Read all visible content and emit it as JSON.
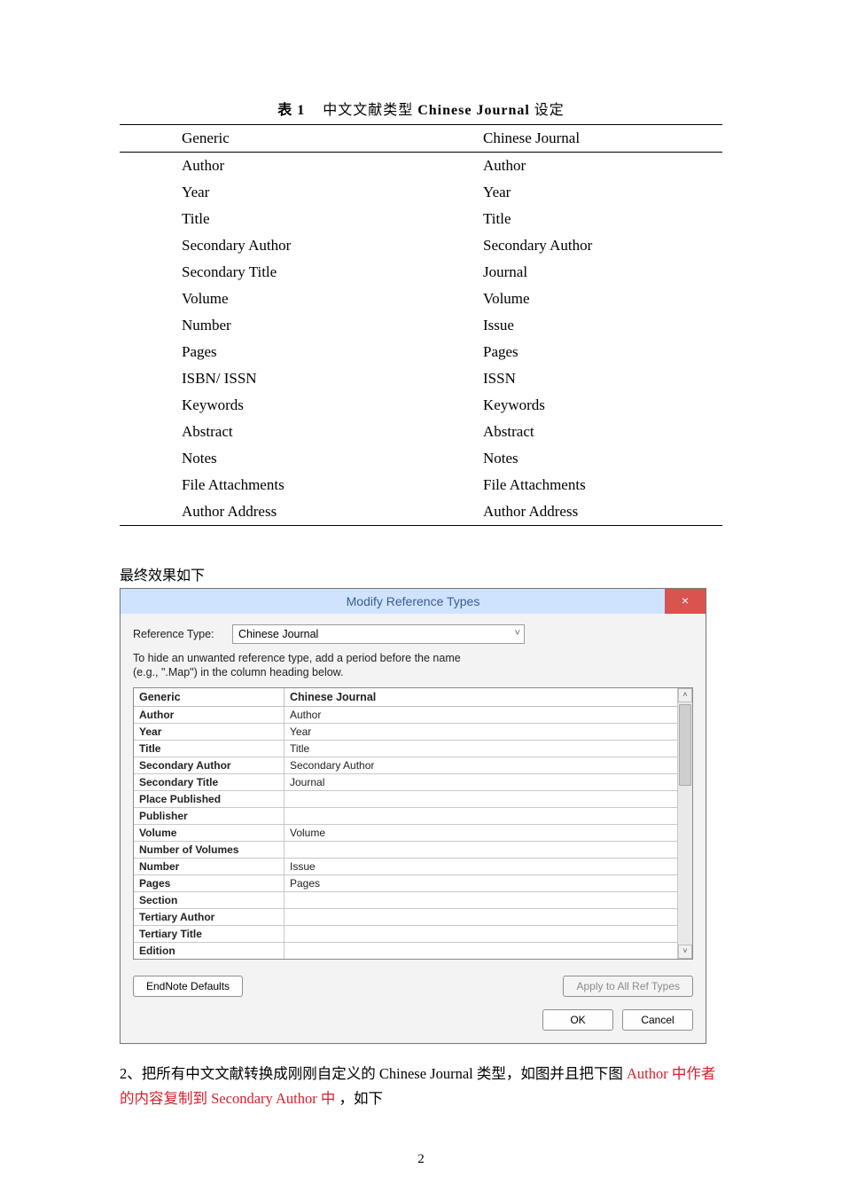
{
  "table1": {
    "caption_prefix": "表 1",
    "caption_text1": "中文文献类型",
    "caption_bold": "Chinese Journal",
    "caption_text2": "设定",
    "headers": {
      "left": "Generic",
      "right": "Chinese Journal"
    },
    "rows": [
      {
        "l": "Author",
        "r": "Author"
      },
      {
        "l": "Year",
        "r": "Year"
      },
      {
        "l": "Title",
        "r": "Title"
      },
      {
        "l": "Secondary Author",
        "r": "Secondary Author"
      },
      {
        "l": "Secondary Title",
        "r": "Journal"
      },
      {
        "l": "Volume",
        "r": "Volume"
      },
      {
        "l": "Number",
        "r": "Issue"
      },
      {
        "l": "Pages",
        "r": "Pages"
      },
      {
        "l": "ISBN/ ISSN",
        "r": "ISSN"
      },
      {
        "l": "Keywords",
        "r": "Keywords"
      },
      {
        "l": "Abstract",
        "r": "Abstract"
      },
      {
        "l": "Notes",
        "r": "Notes"
      },
      {
        "l": "File Attachments",
        "r": "File Attachments"
      },
      {
        "l": "Author Address",
        "r": "Author Address"
      }
    ]
  },
  "narration1": "最终效果如下",
  "dialog": {
    "title": "Modify Reference Types",
    "close_glyph": "×",
    "ref_type_label": "Reference Type:",
    "ref_type_value": "Chinese Journal",
    "hint_line1": "To hide an unwanted reference type, add a period before the name",
    "hint_line2": "(e.g., \".Map\") in the column heading below.",
    "grid": {
      "h1": "Generic",
      "h2": "Chinese Journal",
      "rows": [
        {
          "l": "Author",
          "r": "Author"
        },
        {
          "l": "Year",
          "r": "Year"
        },
        {
          "l": "Title",
          "r": "Title"
        },
        {
          "l": "Secondary Author",
          "r": "Secondary Author"
        },
        {
          "l": "Secondary Title",
          "r": "Journal"
        },
        {
          "l": "Place Published",
          "r": ""
        },
        {
          "l": "Publisher",
          "r": ""
        },
        {
          "l": "Volume",
          "r": "Volume"
        },
        {
          "l": "Number of Volumes",
          "r": ""
        },
        {
          "l": "Number",
          "r": "Issue"
        },
        {
          "l": "Pages",
          "r": "Pages"
        },
        {
          "l": "Section",
          "r": ""
        },
        {
          "l": "Tertiary Author",
          "r": ""
        },
        {
          "l": "Tertiary Title",
          "r": ""
        },
        {
          "l": "Edition",
          "r": ""
        }
      ]
    },
    "buttons": {
      "defaults": "EndNote Defaults",
      "apply_all": "Apply to All Ref Types",
      "ok": "OK",
      "cancel": "Cancel"
    },
    "scroll_up_glyph": "˄",
    "scroll_down_glyph": "˅"
  },
  "doc_p2_a": "2、把所有中文文献转换成刚刚自定义的 Chinese Journal 类型，如图并且把下图 ",
  "doc_p2_red": "Author 中作者的内容复制到 Secondary Author 中",
  "doc_p2_b": "，如下",
  "page_number": "2"
}
